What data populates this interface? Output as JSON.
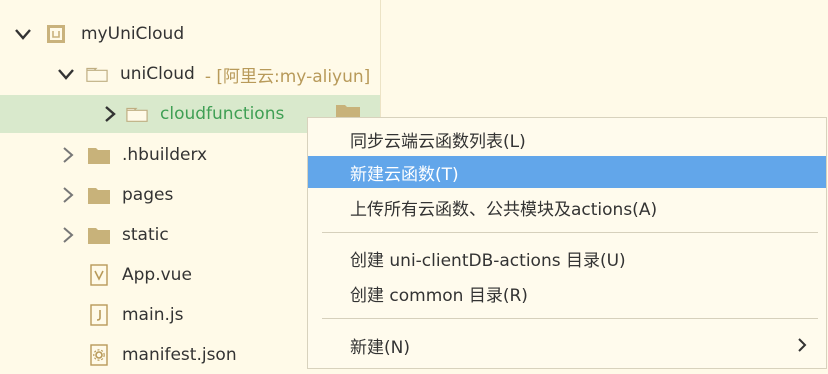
{
  "tree": {
    "root": {
      "label": "myUniCloud"
    },
    "unicloud": {
      "label": "uniCloud",
      "meta": "- [阿里云:my-aliyun]"
    },
    "cloudfunctions": {
      "label": "cloudfunctions"
    },
    "hbuilderx": {
      "label": ".hbuilderx"
    },
    "pages": {
      "label": "pages"
    },
    "static": {
      "label": "static"
    },
    "appvue": {
      "label": "App.vue"
    },
    "mainjs": {
      "label": "main.js"
    },
    "manifest": {
      "label": "manifest.json"
    }
  },
  "context_menu": {
    "items": [
      {
        "label": "同步云端云函数列表(L)"
      },
      {
        "label": "新建云函数(T)"
      },
      {
        "label": "上传所有云函数、公共模块及actions(A)"
      },
      {
        "label": "创建 uni-clientDB-actions 目录(U)"
      },
      {
        "label": "创建 common 目录(R)"
      },
      {
        "label": "新建(N)"
      }
    ]
  },
  "colors": {
    "background": "#fffae8",
    "selected_row": "#d9e9cc",
    "highlight": "#62a6ea",
    "folder": "#c8b27a",
    "green_label": "#3f9f54",
    "meta_label": "#b89a5a"
  }
}
